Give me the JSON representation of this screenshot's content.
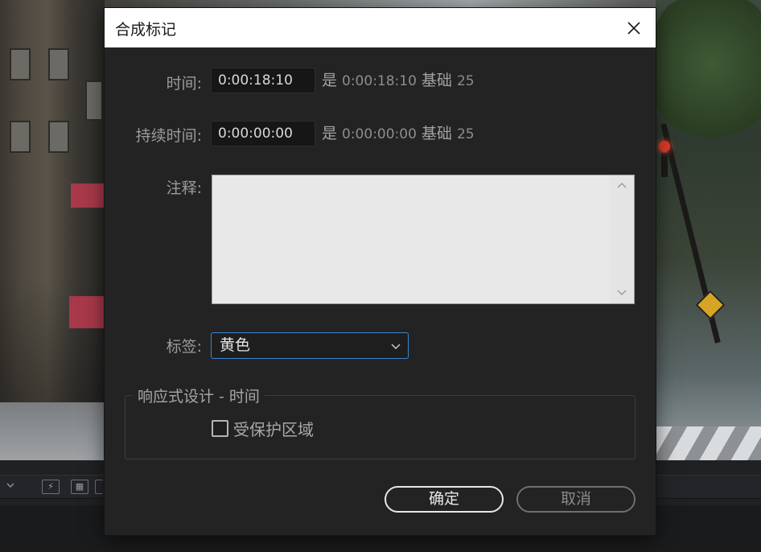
{
  "dialog": {
    "title": "合成标记",
    "time": {
      "label": "时间:",
      "value": "0:00:18:10",
      "is_word": "是",
      "equivalent": "0:00:18:10",
      "base_word": "基础",
      "base_value": "25"
    },
    "duration": {
      "label": "持续时间:",
      "value": "0:00:00:00",
      "is_word": "是",
      "equivalent": "0:00:00:00",
      "base_word": "基础",
      "base_value": "25"
    },
    "comment": {
      "label": "注释:",
      "value": ""
    },
    "tag": {
      "label": "标签:",
      "selected": "黄色"
    },
    "responsive_design": {
      "legend": "响应式设计 - 时间",
      "protected_region_label": "受保护区域",
      "protected_region_checked": false
    },
    "buttons": {
      "ok": "确定",
      "cancel": "取消"
    }
  },
  "colors": {
    "dialog_bg": "#232323",
    "titlebar_bg": "#ffffff",
    "field_bg": "#161616",
    "focus_accent": "#3a86d6",
    "notes_bg": "#e8e8e8"
  }
}
